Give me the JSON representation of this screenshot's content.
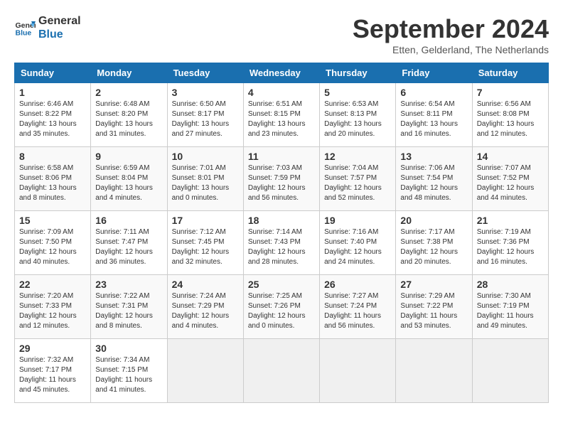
{
  "logo": {
    "line1": "General",
    "line2": "Blue"
  },
  "title": "September 2024",
  "subtitle": "Etten, Gelderland, The Netherlands",
  "days_of_week": [
    "Sunday",
    "Monday",
    "Tuesday",
    "Wednesday",
    "Thursday",
    "Friday",
    "Saturday"
  ],
  "weeks": [
    [
      {
        "day": "1",
        "sunrise": "6:46 AM",
        "sunset": "8:22 PM",
        "daylight": "13 hours and 35 minutes."
      },
      {
        "day": "2",
        "sunrise": "6:48 AM",
        "sunset": "8:20 PM",
        "daylight": "13 hours and 31 minutes."
      },
      {
        "day": "3",
        "sunrise": "6:50 AM",
        "sunset": "8:17 PM",
        "daylight": "13 hours and 27 minutes."
      },
      {
        "day": "4",
        "sunrise": "6:51 AM",
        "sunset": "8:15 PM",
        "daylight": "13 hours and 23 minutes."
      },
      {
        "day": "5",
        "sunrise": "6:53 AM",
        "sunset": "8:13 PM",
        "daylight": "13 hours and 20 minutes."
      },
      {
        "day": "6",
        "sunrise": "6:54 AM",
        "sunset": "8:11 PM",
        "daylight": "13 hours and 16 minutes."
      },
      {
        "day": "7",
        "sunrise": "6:56 AM",
        "sunset": "8:08 PM",
        "daylight": "13 hours and 12 minutes."
      }
    ],
    [
      {
        "day": "8",
        "sunrise": "6:58 AM",
        "sunset": "8:06 PM",
        "daylight": "13 hours and 8 minutes."
      },
      {
        "day": "9",
        "sunrise": "6:59 AM",
        "sunset": "8:04 PM",
        "daylight": "13 hours and 4 minutes."
      },
      {
        "day": "10",
        "sunrise": "7:01 AM",
        "sunset": "8:01 PM",
        "daylight": "13 hours and 0 minutes."
      },
      {
        "day": "11",
        "sunrise": "7:03 AM",
        "sunset": "7:59 PM",
        "daylight": "12 hours and 56 minutes."
      },
      {
        "day": "12",
        "sunrise": "7:04 AM",
        "sunset": "7:57 PM",
        "daylight": "12 hours and 52 minutes."
      },
      {
        "day": "13",
        "sunrise": "7:06 AM",
        "sunset": "7:54 PM",
        "daylight": "12 hours and 48 minutes."
      },
      {
        "day": "14",
        "sunrise": "7:07 AM",
        "sunset": "7:52 PM",
        "daylight": "12 hours and 44 minutes."
      }
    ],
    [
      {
        "day": "15",
        "sunrise": "7:09 AM",
        "sunset": "7:50 PM",
        "daylight": "12 hours and 40 minutes."
      },
      {
        "day": "16",
        "sunrise": "7:11 AM",
        "sunset": "7:47 PM",
        "daylight": "12 hours and 36 minutes."
      },
      {
        "day": "17",
        "sunrise": "7:12 AM",
        "sunset": "7:45 PM",
        "daylight": "12 hours and 32 minutes."
      },
      {
        "day": "18",
        "sunrise": "7:14 AM",
        "sunset": "7:43 PM",
        "daylight": "12 hours and 28 minutes."
      },
      {
        "day": "19",
        "sunrise": "7:16 AM",
        "sunset": "7:40 PM",
        "daylight": "12 hours and 24 minutes."
      },
      {
        "day": "20",
        "sunrise": "7:17 AM",
        "sunset": "7:38 PM",
        "daylight": "12 hours and 20 minutes."
      },
      {
        "day": "21",
        "sunrise": "7:19 AM",
        "sunset": "7:36 PM",
        "daylight": "12 hours and 16 minutes."
      }
    ],
    [
      {
        "day": "22",
        "sunrise": "7:20 AM",
        "sunset": "7:33 PM",
        "daylight": "12 hours and 12 minutes."
      },
      {
        "day": "23",
        "sunrise": "7:22 AM",
        "sunset": "7:31 PM",
        "daylight": "12 hours and 8 minutes."
      },
      {
        "day": "24",
        "sunrise": "7:24 AM",
        "sunset": "7:29 PM",
        "daylight": "12 hours and 4 minutes."
      },
      {
        "day": "25",
        "sunrise": "7:25 AM",
        "sunset": "7:26 PM",
        "daylight": "12 hours and 0 minutes."
      },
      {
        "day": "26",
        "sunrise": "7:27 AM",
        "sunset": "7:24 PM",
        "daylight": "11 hours and 56 minutes."
      },
      {
        "day": "27",
        "sunrise": "7:29 AM",
        "sunset": "7:22 PM",
        "daylight": "11 hours and 53 minutes."
      },
      {
        "day": "28",
        "sunrise": "7:30 AM",
        "sunset": "7:19 PM",
        "daylight": "11 hours and 49 minutes."
      }
    ],
    [
      {
        "day": "29",
        "sunrise": "7:32 AM",
        "sunset": "7:17 PM",
        "daylight": "11 hours and 45 minutes."
      },
      {
        "day": "30",
        "sunrise": "7:34 AM",
        "sunset": "7:15 PM",
        "daylight": "11 hours and 41 minutes."
      },
      null,
      null,
      null,
      null,
      null
    ]
  ]
}
